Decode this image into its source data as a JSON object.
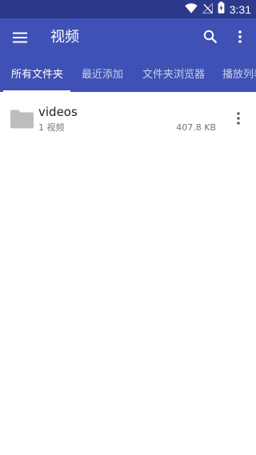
{
  "status_bar": {
    "time": "3:31",
    "icons": [
      "wifi-icon",
      "no-signal-icon",
      "battery-charging-icon"
    ]
  },
  "app_bar": {
    "title": "视频",
    "icons": [
      "menu-icon",
      "search-icon",
      "more-vert-icon"
    ]
  },
  "tabs": [
    {
      "label": "所有文件夹",
      "active": true
    },
    {
      "label": "最近添加",
      "active": false
    },
    {
      "label": "文件夹浏览器",
      "active": false
    },
    {
      "label": "播放列表",
      "active": false
    }
  ],
  "folders": [
    {
      "name": "videos",
      "count": "1 视频",
      "size": "407.8 KB",
      "icon": "folder-icon"
    }
  ],
  "colors": {
    "primary": "#3f51b5",
    "status_bar": "#2c3a8c",
    "folder_icon": "#bdbdbd",
    "text_primary": "#212121",
    "text_secondary": "#757575"
  }
}
